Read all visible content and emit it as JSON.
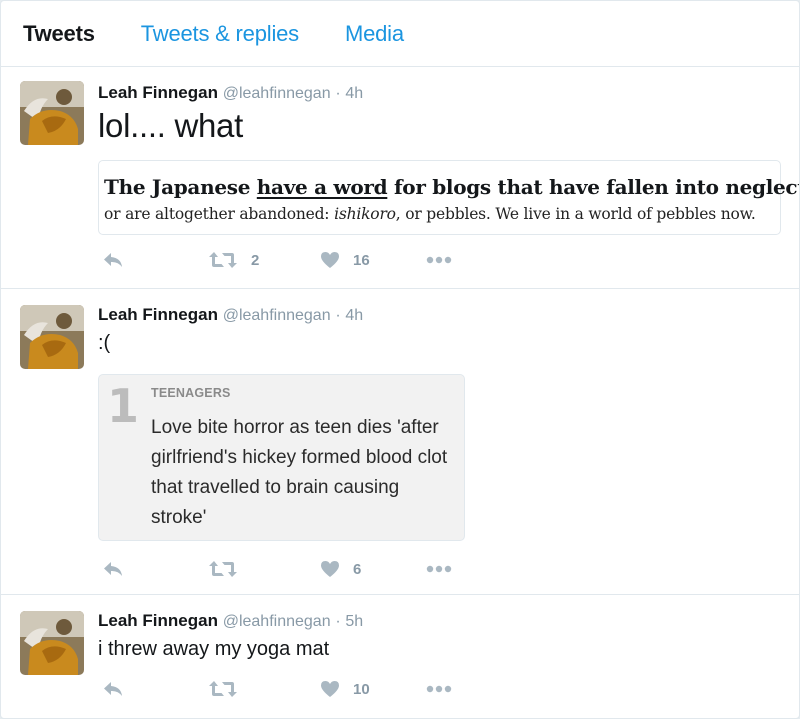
{
  "tabs": [
    "Tweets",
    "Tweets & replies",
    "Media"
  ],
  "tweets": [
    {
      "name": "Leah Finnegan",
      "handle": "@leahfinnegan",
      "time": "4h",
      "text": "lol.... what",
      "quote": {
        "head_before": "The Japanese ",
        "head_link": "have a word",
        "head_after": " for blogs that have fallen into neglect",
        "body_before": "or are altogether abandoned: ",
        "body_italic": "ishikoro",
        "body_after": ", or pebbles. We live in a world of pebbles now."
      },
      "retweets": "2",
      "likes": "16"
    },
    {
      "name": "Leah Finnegan",
      "handle": "@leahfinnegan",
      "time": "4h",
      "text": ":(",
      "card": {
        "number": "1",
        "category": "TEENAGERS",
        "title": "Love bite horror as teen dies 'after girlfriend's hickey formed blood clot that travelled to brain causing stroke'"
      },
      "retweets": "",
      "likes": "6"
    },
    {
      "name": "Leah Finnegan",
      "handle": "@leahfinnegan",
      "time": "5h",
      "text": "i threw away my yoga mat",
      "retweets": "",
      "likes": "10"
    }
  ],
  "icons": {
    "reply": "reply-icon",
    "retweet": "retweet-icon",
    "like": "heart-icon",
    "more": "more-icon"
  },
  "colors": {
    "accent": "#1b95e0",
    "icon_gray": "#aab8c2",
    "meta_gray": "#8899a6"
  }
}
